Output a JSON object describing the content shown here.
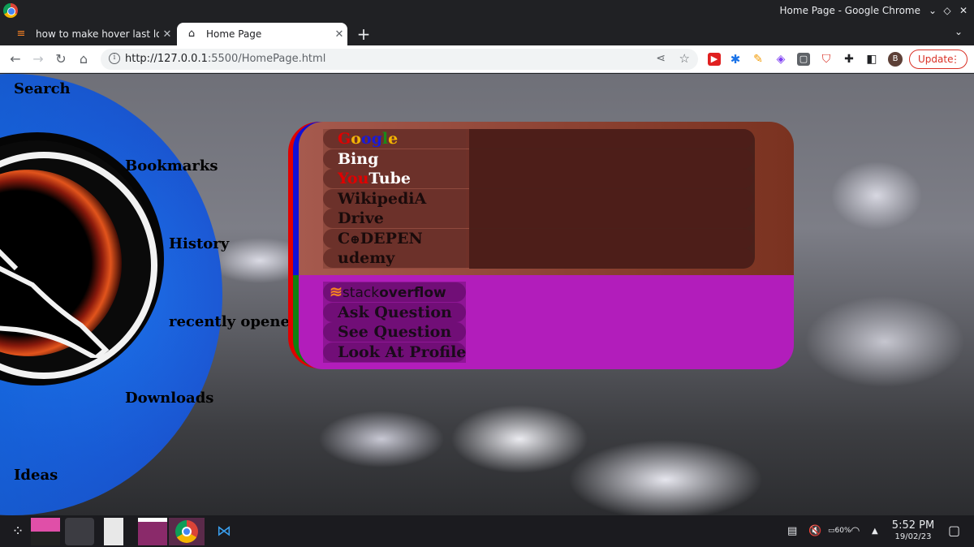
{
  "window": {
    "title": "Home Page - Google Chrome"
  },
  "tabs": [
    {
      "label": "how to make hover last longe",
      "icon": "stackoverflow-icon"
    },
    {
      "label": "Home Page",
      "icon": "home-icon"
    }
  ],
  "address_bar": {
    "url_scheme_host": "http://127.0.0.1",
    "url_rest": ":5500/HomePage.html"
  },
  "toolbar": {
    "update_label": "Update",
    "avatar_letter": "B"
  },
  "sidebar": {
    "items": [
      {
        "label": "Search"
      },
      {
        "label": "Bookmarks"
      },
      {
        "label": "History"
      },
      {
        "label": "recently opened"
      },
      {
        "label": "Downloads"
      },
      {
        "label": "Ideas"
      }
    ]
  },
  "engines": {
    "google": [
      "G",
      "o",
      "o",
      "g",
      "l",
      "e"
    ],
    "google_colors": [
      "#e00000",
      "#f4b400",
      "#1a1ad8",
      "#1a1ad8",
      "#1a8a1a",
      "#f4b400"
    ],
    "bing": "Bing",
    "youtube_you": "You",
    "youtube_tube": "Tube",
    "wikipedia": "WikipediA",
    "drive": "Drive",
    "codepen_c": "C",
    "codepen_rest": "DEPEN",
    "udemy": "udemy"
  },
  "stackoverflow": {
    "brand_light": "stack",
    "brand_bold": "overflow",
    "items": [
      {
        "label": "Ask Question"
      },
      {
        "label": "See Question"
      },
      {
        "label": "Look At Profile"
      }
    ]
  },
  "taskbar": {
    "time": "5:52 PM",
    "date": "19/02/23",
    "battery": "60%"
  }
}
